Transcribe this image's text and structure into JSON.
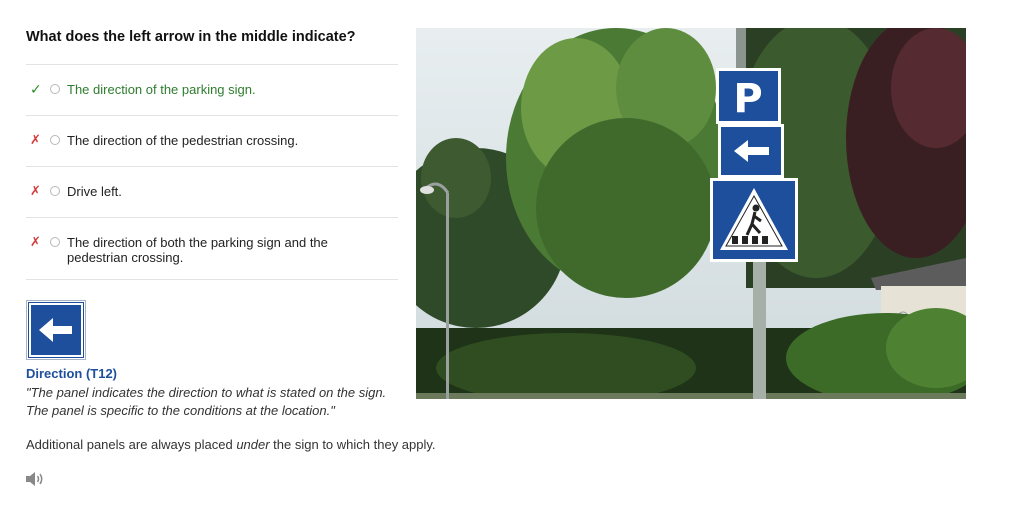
{
  "question": "What does the left arrow in the middle indicate?",
  "answers": [
    {
      "mark": "✓",
      "text": "The direction of the parking sign.",
      "correct": true
    },
    {
      "mark": "✗",
      "text": "The direction of the pedestrian crossing.",
      "correct": false
    },
    {
      "mark": "✗",
      "text": "Drive left.",
      "correct": false
    },
    {
      "mark": "✗",
      "text": "The direction of both the parking sign and the pedestrian crossing.",
      "correct": false
    }
  ],
  "explanation": {
    "sign_icon": "left-arrow-panel-icon",
    "title": "Direction (T12)",
    "description": "\"The panel indicates the direction to what is stated on the sign. The panel is specific to the conditions at the location.\"",
    "note_before": "Additional panels are always placed ",
    "note_emphasis": "under",
    "note_after": " the sign to which they apply."
  },
  "photo": {
    "parking_sign_text": "P",
    "icon": "road-signs-photo"
  },
  "audio": {
    "icon": "speaker-icon"
  },
  "colors": {
    "correct_green": "#2e7d2e",
    "wrong_red": "#d23b3b",
    "sign_blue": "#1d4f9c"
  }
}
